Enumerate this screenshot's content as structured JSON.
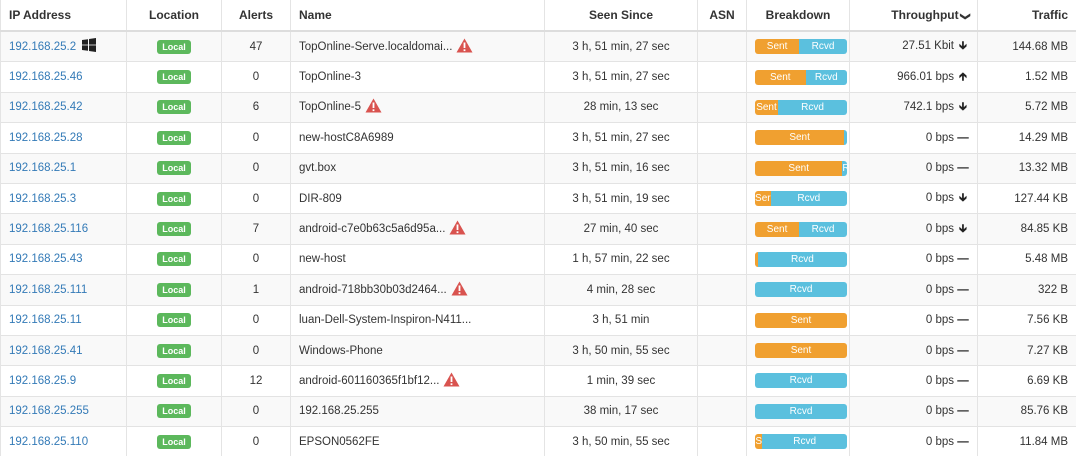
{
  "columns": {
    "ip": "IP Address",
    "location": "Location",
    "alerts": "Alerts",
    "name": "Name",
    "seen": "Seen Since",
    "asn": "ASN",
    "breakdown": "Breakdown",
    "throughput": "Throughput",
    "traffic": "Traffic"
  },
  "labels": {
    "sent": "Sent",
    "rcvd": "Rcvd",
    "location_badge": "Local"
  },
  "colors": {
    "sent": "#f0a030",
    "rcvd": "#5bc0de",
    "badge": "#5cb85c",
    "warn": "#d9534f",
    "link": "#337ab7"
  },
  "hosts": [
    {
      "ip": "192.168.25.2",
      "os_icon": "windows-icon",
      "location": "Local",
      "alerts": "47",
      "name": "TopOnline-Serve.localdomai...",
      "warn": true,
      "seen": "3 h, 51 min, 27 sec",
      "asn": "",
      "sent_pct": 48,
      "sent_label": "Sent",
      "rcvd_label": "Rcvd",
      "throughput": "27.51 Kbit",
      "trend": "down",
      "traffic": "144.68 MB"
    },
    {
      "ip": "192.168.25.46",
      "os_icon": "",
      "location": "Local",
      "alerts": "0",
      "name": "TopOnline-3",
      "warn": false,
      "seen": "3 h, 51 min, 27 sec",
      "asn": "",
      "sent_pct": 55,
      "sent_label": "Sent",
      "rcvd_label": "Rcvd",
      "throughput": "966.01 bps",
      "trend": "up",
      "traffic": "1.52 MB"
    },
    {
      "ip": "192.168.25.42",
      "os_icon": "",
      "location": "Local",
      "alerts": "6",
      "name": "TopOnline-5",
      "warn": true,
      "seen": "28 min, 13 sec",
      "asn": "",
      "sent_pct": 25,
      "sent_label": "Sent",
      "rcvd_label": "Rcvd",
      "throughput": "742.1 bps",
      "trend": "down",
      "traffic": "5.72 MB"
    },
    {
      "ip": "192.168.25.28",
      "os_icon": "",
      "location": "Local",
      "alerts": "0",
      "name": "new-hostC8A6989",
      "warn": false,
      "seen": "3 h, 51 min, 27 sec",
      "asn": "",
      "sent_pct": 97,
      "sent_label": "Sent",
      "rcvd_label": "",
      "throughput": "0 bps",
      "trend": "flat",
      "traffic": "14.29 MB"
    },
    {
      "ip": "192.168.25.1",
      "os_icon": "",
      "location": "Local",
      "alerts": "0",
      "name": "gvt.box",
      "warn": false,
      "seen": "3 h, 51 min, 16 sec",
      "asn": "",
      "sent_pct": 95,
      "sent_label": "Sent",
      "rcvd_label": "R",
      "throughput": "0 bps",
      "trend": "flat",
      "traffic": "13.32 MB"
    },
    {
      "ip": "192.168.25.3",
      "os_icon": "",
      "location": "Local",
      "alerts": "0",
      "name": "DIR-809",
      "warn": false,
      "seen": "3 h, 51 min, 19 sec",
      "asn": "",
      "sent_pct": 17,
      "sent_label": "Ser",
      "rcvd_label": "Rcvd",
      "throughput": "0 bps",
      "trend": "down",
      "traffic": "127.44 KB"
    },
    {
      "ip": "192.168.25.116",
      "os_icon": "",
      "location": "Local",
      "alerts": "7",
      "name": "android-c7e0b63c5a6d95a...",
      "warn": true,
      "seen": "27 min, 40 sec",
      "asn": "",
      "sent_pct": 48,
      "sent_label": "Sent",
      "rcvd_label": "Rcvd",
      "throughput": "0 bps",
      "trend": "down",
      "traffic": "84.85 KB"
    },
    {
      "ip": "192.168.25.43",
      "os_icon": "",
      "location": "Local",
      "alerts": "0",
      "name": "new-host",
      "warn": false,
      "seen": "1 h, 57 min, 22 sec",
      "asn": "",
      "sent_pct": 3,
      "sent_label": "",
      "rcvd_label": "Rcvd",
      "throughput": "0 bps",
      "trend": "flat",
      "traffic": "5.48 MB"
    },
    {
      "ip": "192.168.25.111",
      "os_icon": "",
      "location": "Local",
      "alerts": "1",
      "name": "android-718bb30b03d2464...",
      "warn": true,
      "seen": "4 min, 28 sec",
      "asn": "",
      "sent_pct": 0,
      "sent_label": "",
      "rcvd_label": "Rcvd",
      "throughput": "0 bps",
      "trend": "flat",
      "traffic": "322 B"
    },
    {
      "ip": "192.168.25.11",
      "os_icon": "",
      "location": "Local",
      "alerts": "0",
      "name": "luan-Dell-System-Inspiron-N411...",
      "warn": false,
      "seen": "3 h, 51 min",
      "asn": "",
      "sent_pct": 100,
      "sent_label": "Sent",
      "rcvd_label": "",
      "throughput": "0 bps",
      "trend": "flat",
      "traffic": "7.56 KB"
    },
    {
      "ip": "192.168.25.41",
      "os_icon": "",
      "location": "Local",
      "alerts": "0",
      "name": "Windows-Phone",
      "warn": false,
      "seen": "3 h, 50 min, 55 sec",
      "asn": "",
      "sent_pct": 100,
      "sent_label": "Sent",
      "rcvd_label": "",
      "throughput": "0 bps",
      "trend": "flat",
      "traffic": "7.27 KB"
    },
    {
      "ip": "192.168.25.9",
      "os_icon": "",
      "location": "Local",
      "alerts": "12",
      "name": "android-601160365f1bf12...",
      "warn": true,
      "seen": "1 min, 39 sec",
      "asn": "",
      "sent_pct": 0,
      "sent_label": "",
      "rcvd_label": "Rcvd",
      "throughput": "0 bps",
      "trend": "flat",
      "traffic": "6.69 KB"
    },
    {
      "ip": "192.168.25.255",
      "os_icon": "",
      "location": "Local",
      "alerts": "0",
      "name": "192.168.25.255",
      "warn": false,
      "seen": "38 min, 17 sec",
      "asn": "",
      "sent_pct": 0,
      "sent_label": "",
      "rcvd_label": "Rcvd",
      "throughput": "0 bps",
      "trend": "flat",
      "traffic": "85.76 KB"
    },
    {
      "ip": "192.168.25.110",
      "os_icon": "",
      "location": "Local",
      "alerts": "0",
      "name": "EPSON0562FE",
      "warn": false,
      "seen": "3 h, 50 min, 55 sec",
      "asn": "",
      "sent_pct": 8,
      "sent_label": "S",
      "rcvd_label": "Rcvd",
      "throughput": "0 bps",
      "trend": "flat",
      "traffic": "11.84 MB"
    }
  ]
}
